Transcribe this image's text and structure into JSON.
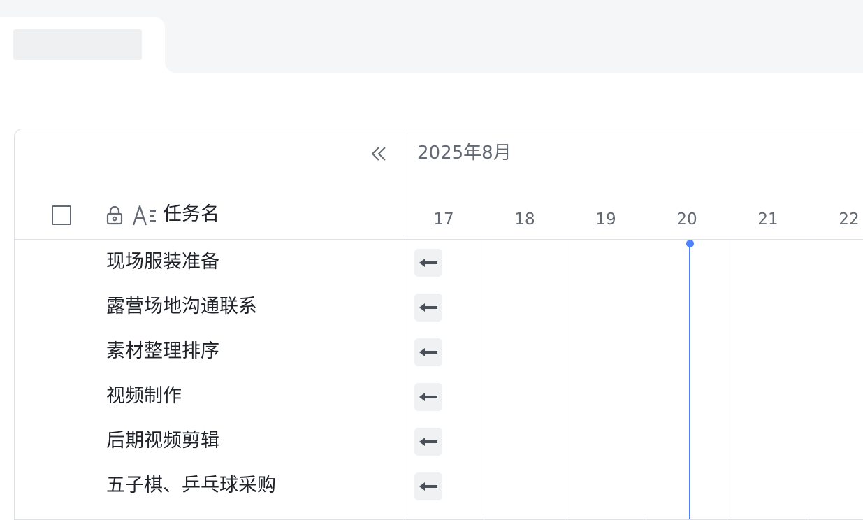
{
  "window": {
    "tab_placeholder": ""
  },
  "gantt": {
    "column_title": "任务名",
    "month_label": "2025年8月",
    "days": [
      "17",
      "18",
      "19",
      "20",
      "21",
      "22"
    ],
    "today": "20",
    "tasks": [
      {
        "name": "现场服装准备"
      },
      {
        "name": "露营场地沟通联系"
      },
      {
        "name": "素材整理排序"
      },
      {
        "name": "视频制作"
      },
      {
        "name": "后期视频剪辑"
      },
      {
        "name": "五子棋、乒乓球采购"
      }
    ],
    "icons": {
      "collapse": "double-chevron-left-icon",
      "lock": "lock-icon",
      "field_type": "text-field-icon",
      "scroll_back": "arrow-left-icon"
    },
    "colors": {
      "today_line": "#4e83fd",
      "border": "#dee0e3",
      "muted_text": "#646a73"
    }
  }
}
